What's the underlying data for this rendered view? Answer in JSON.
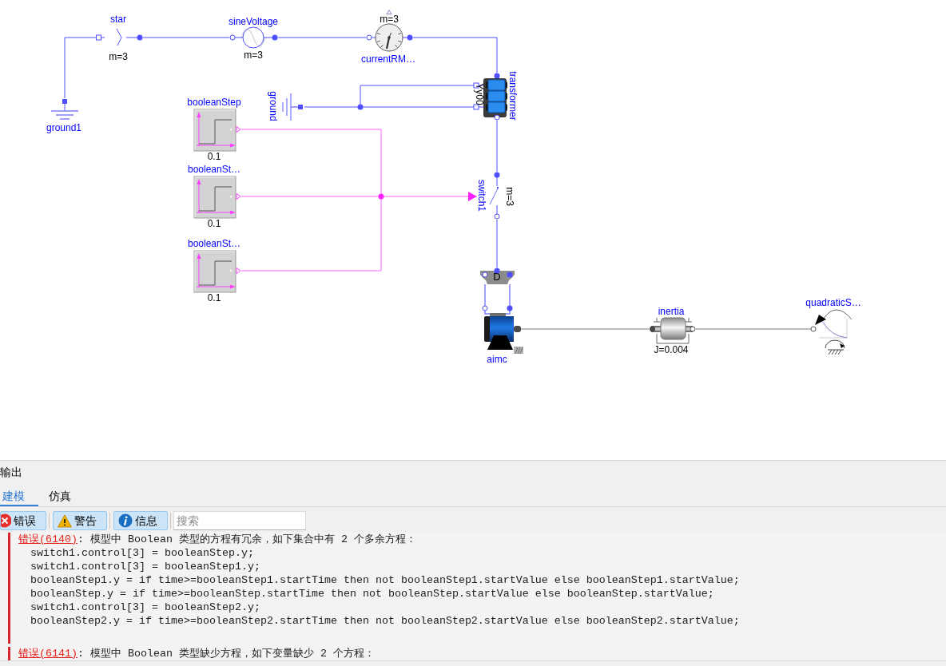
{
  "diagram": {
    "components": [
      {
        "kind": "ground",
        "name": "ground1"
      },
      {
        "kind": "star",
        "name": "star",
        "parameter": "m=3"
      },
      {
        "kind": "sine_voltage",
        "name": "sineVoltage",
        "parameter": "m=3"
      },
      {
        "kind": "rms_sensor",
        "name": "currentRM…",
        "parameter": "m=3"
      },
      {
        "kind": "transformer",
        "name": "transformer",
        "parameter": "Yy00"
      },
      {
        "kind": "ground",
        "name": "ground"
      },
      {
        "kind": "boolean_step",
        "name": "booleanStep",
        "parameter": "0.1"
      },
      {
        "kind": "boolean_step",
        "name": "booleanSt…",
        "parameter": "0.1"
      },
      {
        "kind": "boolean_step",
        "name": "booleanSt…",
        "parameter": "0.1"
      },
      {
        "kind": "switch",
        "name": "switch1",
        "parameter": "m=3"
      },
      {
        "kind": "terminal_box",
        "symbol": "D"
      },
      {
        "kind": "motor",
        "name": "aimc"
      },
      {
        "kind": "inertia",
        "name": "inertia",
        "parameter": "J=0.004"
      },
      {
        "kind": "quadratic_load",
        "name": "quadraticS…"
      }
    ]
  },
  "output_panel": {
    "title": "输出",
    "tabs": [
      {
        "label": "建模",
        "selected": true
      },
      {
        "label": "仿真",
        "selected": false
      }
    ],
    "filters": [
      {
        "kind": "error",
        "label": "错误",
        "selected": true
      },
      {
        "kind": "warning",
        "label": "警告",
        "selected": true
      },
      {
        "kind": "info",
        "label": "信息",
        "selected": true
      }
    ],
    "search": {
      "placeholder": "搜索"
    },
    "messages": [
      {
        "kind": "error",
        "code": "错误(6140)",
        "text": ": 模型中 Boolean 类型的方程有冗余，如下集合中有 2 个多余方程：",
        "lines": [
          "switch1.control[3] = booleanStep.y;",
          "switch1.control[3] = booleanStep1.y;",
          "booleanStep1.y = if time>=booleanStep1.startTime then not booleanStep1.startValue else booleanStep1.startValue;",
          "booleanStep.y = if time>=booleanStep.startTime then not booleanStep.startValue else booleanStep.startValue;",
          "switch1.control[3] = booleanStep2.y;",
          "booleanStep2.y = if time>=booleanStep2.startTime then not booleanStep2.startValue else booleanStep2.startValue;"
        ]
      },
      {
        "kind": "error",
        "code": "错误(6141)",
        "text": ": 模型中 Boolean 类型缺少方程，如下变量缺少 2 个方程："
      }
    ]
  }
}
